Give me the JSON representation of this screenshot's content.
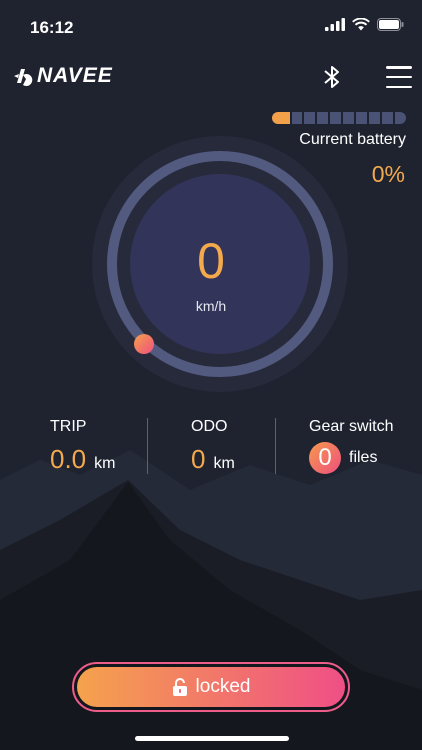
{
  "status_bar": {
    "time": "16:12",
    "icons": [
      "signal-icon",
      "wifi-icon",
      "battery-icon"
    ]
  },
  "header": {
    "brand": "NAVEE",
    "icons": [
      "navee-logo-icon",
      "bluetooth-icon",
      "menu-icon"
    ]
  },
  "battery": {
    "label": "Current battery",
    "value": "0%",
    "level_fraction": 0.0,
    "segments": 10
  },
  "speed": {
    "value": "0",
    "unit": "km/h"
  },
  "stats": {
    "trip": {
      "label": "TRIP",
      "value": "0.0",
      "unit": "km"
    },
    "odo": {
      "label": "ODO",
      "value": "0",
      "unit": "km"
    },
    "gear": {
      "label": "Gear switch",
      "value": "0",
      "unit": "files"
    }
  },
  "lock_button": {
    "label": "locked",
    "icon": "unlock-icon"
  },
  "colors": {
    "accent_orange": "#f3a94c",
    "accent_pink": "#ef4f86",
    "background": "#1f2330",
    "track": "#4a5275"
  }
}
